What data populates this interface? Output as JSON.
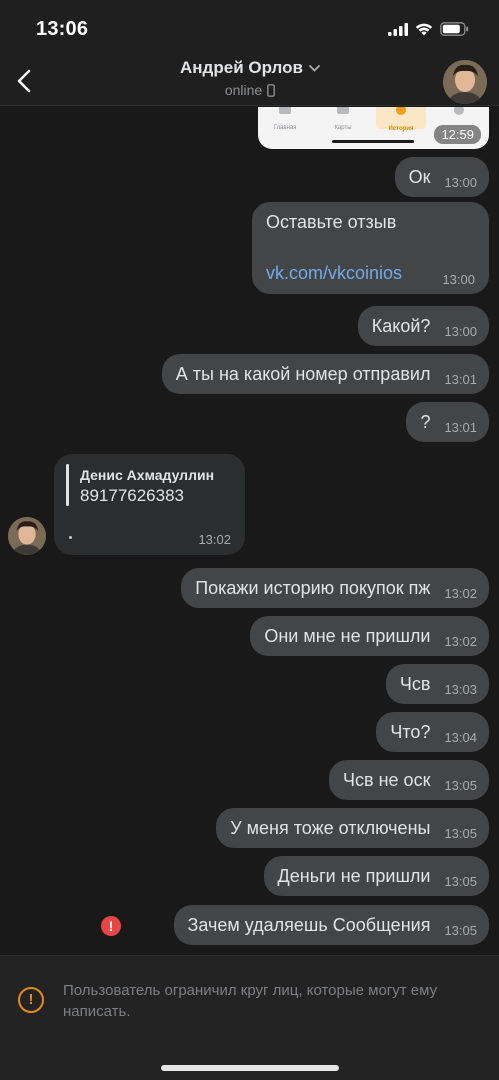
{
  "status_bar": {
    "time": "13:06"
  },
  "header": {
    "title": "Андрей Орлов",
    "subtitle": "online",
    "back_icon": "chevron-left-icon",
    "title_icon": "chevron-down-icon",
    "status_icon": "phone-icon"
  },
  "photo_preview": {
    "tabs": [
      "Главная",
      "Карты",
      "История",
      ""
    ],
    "active_tab": 2,
    "time": "12:59"
  },
  "messages": [
    {
      "text": "Ок",
      "time": "13:00"
    },
    {
      "text": "Оставьте отзыв",
      "link": "vk.com/vkcoinios",
      "time": "13:00"
    },
    {
      "text": "Какой?",
      "time": "13:00"
    },
    {
      "text": "А ты на какой номер отправил",
      "time": "13:01"
    },
    {
      "text": "?",
      "time": "13:01"
    },
    {
      "text": "Покажи историю покупок пж",
      "time": "13:02"
    },
    {
      "text": "Они мне не пришли",
      "time": "13:02"
    },
    {
      "text": "Чсв",
      "time": "13:03"
    },
    {
      "text": "Что?",
      "time": "13:04"
    },
    {
      "text": "Чсв не оск",
      "time": "13:05"
    },
    {
      "text": "У меня тоже отключены",
      "time": "13:05"
    },
    {
      "text": "Деньги не пришли",
      "time": "13:05"
    },
    {
      "text": "Зачем удаляешь Сообщения",
      "time": "13:05"
    }
  ],
  "forwarded": {
    "author": "Денис Ахмадуллин",
    "text": "89177626383",
    "time": "13:02"
  },
  "error_icon": "!",
  "restriction": {
    "icon": "!",
    "text": "Пользователь ограничил круг лиц, которые могут ему написать."
  },
  "colors": {
    "background": "#19191a",
    "bubble": "#444547",
    "link": "#71aaeb",
    "warning": "#e38b16",
    "error": "#e64646"
  }
}
